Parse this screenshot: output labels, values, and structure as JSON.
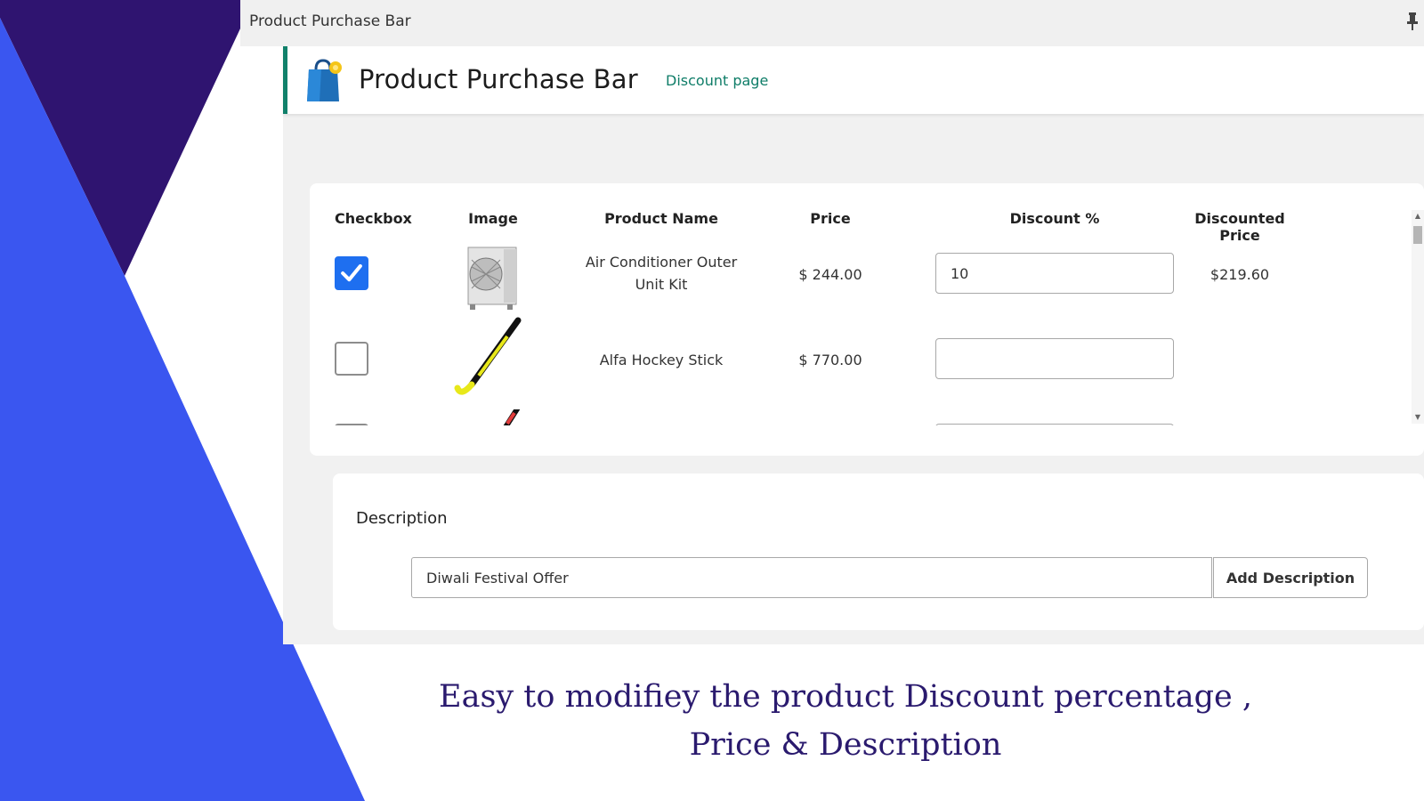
{
  "window": {
    "title": "Product Purchase Bar"
  },
  "header": {
    "title": "Product Purchase Bar",
    "discount_link": "Discount page",
    "logo_icon": "shopping-bag-icon"
  },
  "table": {
    "columns": [
      "Checkbox",
      "Image",
      "Product Name",
      "Price",
      "Discount %",
      "Discounted Price"
    ],
    "rows": [
      {
        "checked": true,
        "image_icon": "air-conditioner-unit-image",
        "name_line1": "Air Conditioner Outer",
        "name_line2": "Unit Kit",
        "price": "$ 244.00",
        "discount": "10",
        "discounted_price": "$219.60"
      },
      {
        "checked": false,
        "image_icon": "hockey-stick-image",
        "name": "Alfa Hockey Stick",
        "price": "$ 770.00",
        "discount": "",
        "discounted_price": ""
      }
    ]
  },
  "description": {
    "label": "Description",
    "value": "Diwali Festival Offer",
    "button_label": "Add Description"
  },
  "caption": {
    "line1": "Easy to modifiey the product Discount percentage ,",
    "line2": "Price  & Description"
  },
  "colors": {
    "accent_green": "#10806a",
    "checkbox_blue": "#1e6ff0",
    "bg_navy": "#2f1470",
    "bg_blue": "#3a56f0",
    "caption": "#2a1a6e"
  }
}
